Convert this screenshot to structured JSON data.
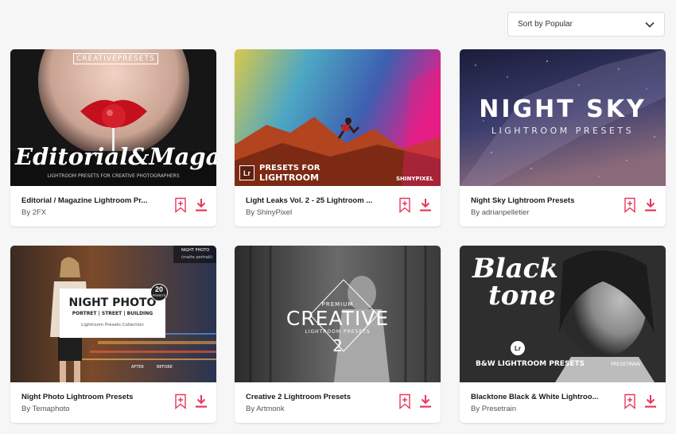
{
  "sort": {
    "label": "Sort by Popular"
  },
  "colors": {
    "accent": "#e8365d"
  },
  "cards": [
    {
      "title": "Editorial / Magazine Lightroom Pr...",
      "author": "By 2FX",
      "thumb": {
        "brand": "CREATIVEPRESETS",
        "headline": "Editorial&Magazine",
        "sub": "LIGHTROOM PRESETS FOR CREATIVE PHOTOGRAPHERS"
      }
    },
    {
      "title": "Light Leaks Vol. 2 - 25 Lightroom ...",
      "author": "By ShinyPixel",
      "thumb": {
        "badge": "Lr",
        "line1": "PRESETS FOR",
        "line2": "LIGHTROOM",
        "brand": "SHINYPIXEL"
      }
    },
    {
      "title": "Night Sky Lightroom Presets",
      "author": "By adrianpelletier",
      "thumb": {
        "headline": "NIGHT SKY",
        "sub": "LIGHTROOM PRESETS"
      }
    },
    {
      "title": "Night Photo Lightroom Presets",
      "author": "By Temaphoto",
      "thumb": {
        "corner": "NIGHT PHOTO",
        "corner2": "(matte portrait)",
        "headline": "NIGHT PHOTO",
        "tags": "PORTRET | STREET | BUILDING",
        "sub": "Lightroom Presets Collection",
        "count": "20",
        "count_label": "PRESETS",
        "after": "AFTER",
        "before": "BEFORE"
      }
    },
    {
      "title": "Creative 2 Lightroom Presets",
      "author": "By Artmonk",
      "thumb": {
        "premium": "PREMIUM",
        "headline": "CREATIVE",
        "sub": "LIGHTROOM PRESETS",
        "number": "2"
      }
    },
    {
      "title": "Blacktone Black & White Lightroo...",
      "author": "By Presetrain",
      "thumb": {
        "line1": "Black",
        "line2": "tone",
        "badge": "Lr",
        "sub": "B&W LIGHTROOM PRESETS",
        "brand": "PRESETRAIN"
      }
    }
  ]
}
